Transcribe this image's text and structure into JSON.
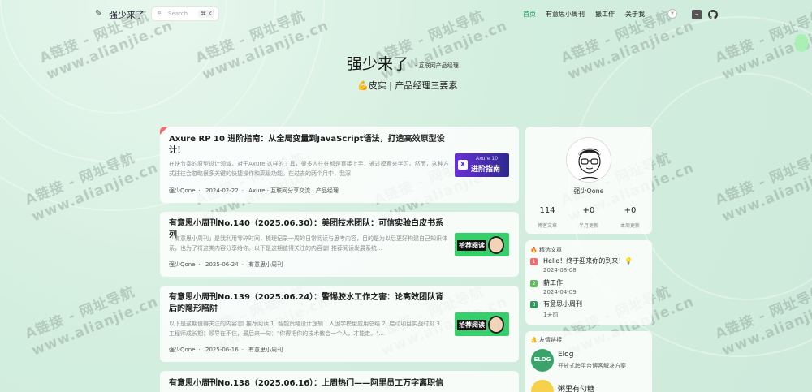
{
  "site": {
    "name": "强少来了"
  },
  "search": {
    "placeholder": "Search",
    "shortcut": "⌘ K"
  },
  "nav": {
    "links": [
      "首页",
      "有意思小周刊",
      "搬工作",
      "关于我"
    ]
  },
  "hero": {
    "title": "强少来了",
    "subtitle": "- 互联网产品经理",
    "tagline": "💪皮实 | 产品经理三要素"
  },
  "watermark": [
    "A链接 - 网址导航",
    "www.alianjie.cn"
  ],
  "posts": [
    {
      "title": "Axure RP 10 进阶指南：从全局变量到JavaScript语法，打造高效原型设计！",
      "excerpt": "在快节奏的原型设计领域，对于Axure 这样的工具，很多人往往都是直接上手，通过摸索来学习。然而，这种方式往往会忽略很多关键的快捷操作和高级功能。在过去的两个月中，我深",
      "author": "强少Qone",
      "date": "2024-02-22",
      "tags": "Axure · 互联网分享交流 · 产品经理",
      "thumb_text": [
        "Axure 10",
        "进阶指南"
      ]
    },
    {
      "title": "有意思小周刊No.140（2025.06.30）：美团技术团队：可信实验白皮书系列",
      "excerpt": "「有意思小周刊」是我利用零碎时间，梳理记录一周的日常阅读与思考内容，目的是为以后更好构建自己知识体系，也为了将这类内容分享给你。以下是这期值得关注的内容📰 推荐阅读发展系统...",
      "author": "强少Qone",
      "date": "2025-06-24",
      "tags": "有意思小周刊",
      "thumb_text": [
        "拾荐阅读"
      ]
    },
    {
      "title": "有意思小周刊No.139（2025.06.24）：警惕胶水工作之害：论高效团队背后的隐形陷阱",
      "excerpt": "以下是这期值得关注的内容📰 推荐阅读 1. 智能策略设计逻辑丨人因学模型应用总结 2. 启动项目实战时刻 3. 工程师成长期：领导在不住，最后来一句：\"你得把你的技术教会一个人，才能走。\"...",
      "author": "强少Qone",
      "date": "2025-06-16",
      "tags": "有意思小周刊",
      "thumb_text": [
        "拾荐阅读"
      ]
    },
    {
      "title": "有意思小周刊No.138（2025.06.16）：上周热门——阿里员工万字离职信"
    }
  ],
  "profile": {
    "name": "强少Qone",
    "stats": [
      {
        "value": "114",
        "label": "博客文章"
      },
      {
        "value": "+0",
        "label": "半月更新"
      },
      {
        "value": "+0",
        "label": "本周更新"
      }
    ]
  },
  "recommended": {
    "title": "🔥 精选文章",
    "items": [
      {
        "rank": "1",
        "title": "Hello！终于迎来你的到来！💡",
        "date": "2024-08-08",
        "color": "#f26d6d"
      },
      {
        "rank": "2",
        "title": "薪工作",
        "date": "2024-04-09",
        "color": "#5cbf5c"
      },
      {
        "rank": "3",
        "title": "有意思小周刊",
        "date": "1天前",
        "color": "#2f9a5a"
      }
    ]
  },
  "friends": {
    "title": "🔔 友情链接",
    "items": [
      {
        "name": "Elog",
        "desc": "开放式跨平台博客解决方案",
        "logo": "ELOG"
      },
      {
        "name": "粥里有勺糖",
        "desc": ""
      }
    ]
  }
}
